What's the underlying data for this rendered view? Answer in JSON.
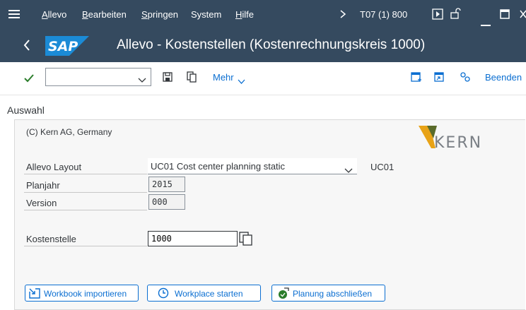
{
  "menu": {
    "items": [
      "Allevo",
      "Bearbeiten",
      "Springen",
      "System",
      "Hilfe"
    ],
    "session": "T07 (1) 800"
  },
  "title": {
    "logo": "SAP",
    "text": "Allevo - Kostenstellen (Kostenrechnungskreis 1000)"
  },
  "toolbar": {
    "command_value": "",
    "more_label": "Mehr",
    "exit_label": "Beenden"
  },
  "section": {
    "title": "Auswahl",
    "copyright": "(C) Kern AG, Germany",
    "brand_logo": "KERN"
  },
  "form": {
    "layout": {
      "label": "Allevo Layout",
      "value": "UC01 Cost center planning static",
      "code": "UC01"
    },
    "planjahr": {
      "label": "Planjahr",
      "value": "2015"
    },
    "version": {
      "label": "Version",
      "value": "000"
    },
    "kostenstelle": {
      "label": "Kostenstelle",
      "value": "1000"
    }
  },
  "buttons": {
    "import": "Workbook importieren",
    "workplace": "Workplace starten",
    "finish": "Planung abschließen"
  },
  "colors": {
    "shell": "#354a5f",
    "accent": "#0a6ed1",
    "check": "#2b7d2b",
    "kern_orange": "#e8a317"
  }
}
